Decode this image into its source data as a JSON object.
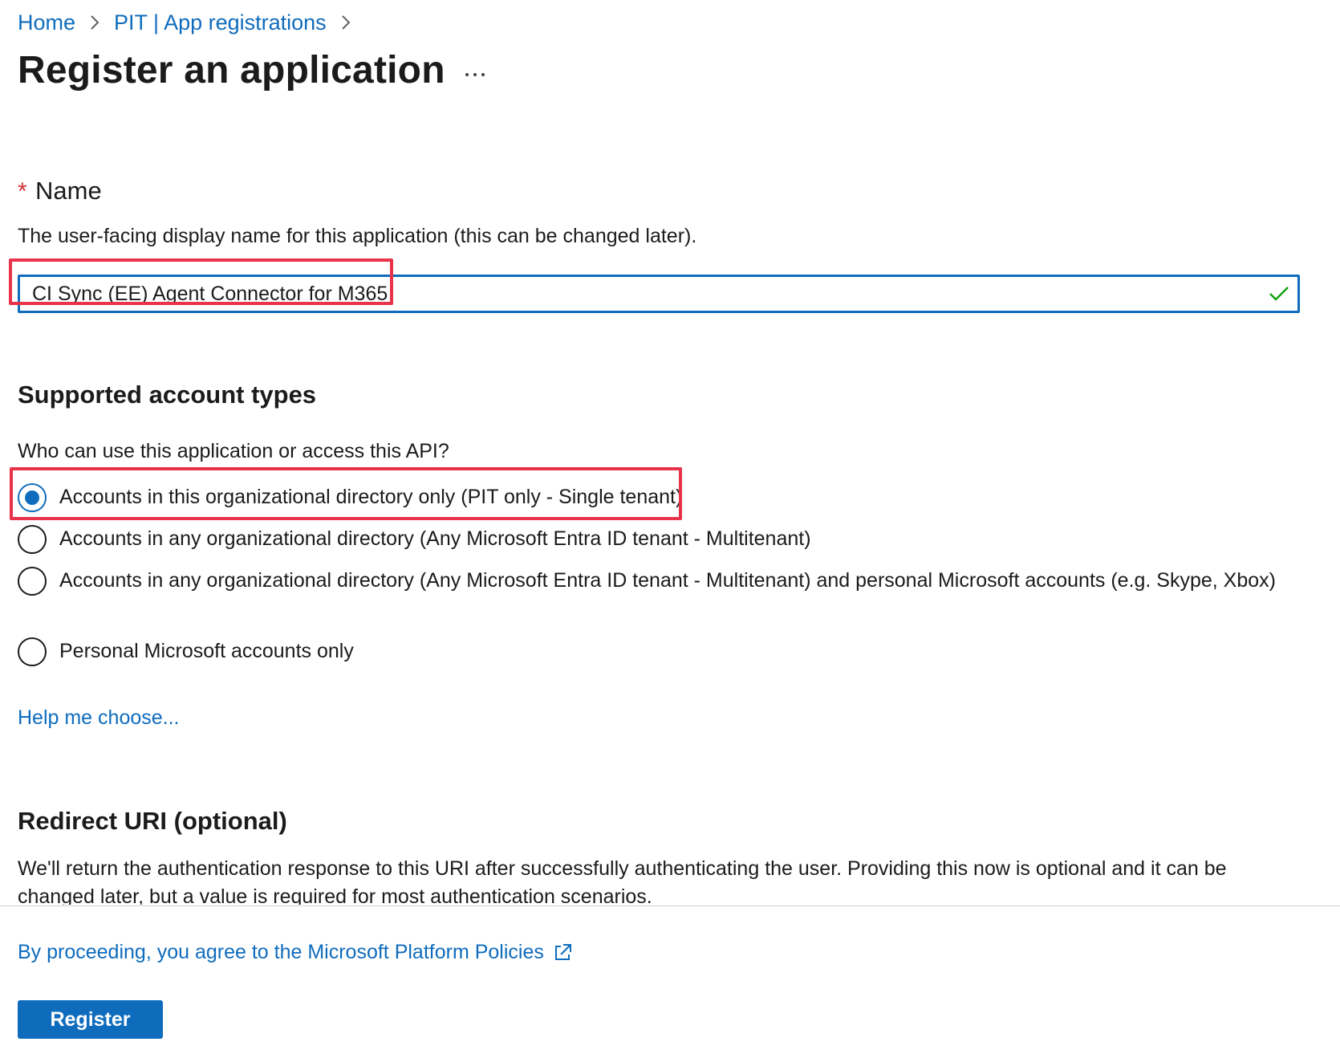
{
  "breadcrumb": {
    "items": [
      {
        "label": "Home"
      },
      {
        "label": "PIT | App registrations"
      }
    ]
  },
  "page": {
    "title": "Register an application",
    "more_icon": "ellipsis-icon"
  },
  "name_section": {
    "required_marker": "*",
    "label": "Name",
    "description": "The user-facing display name for this application (this can be changed later).",
    "input_value": "CI Sync (EE) Agent Connector for M365",
    "valid_icon": "checkmark-icon"
  },
  "account_types": {
    "title": "Supported account types",
    "question": "Who can use this application or access this API?",
    "options": [
      {
        "label": "Accounts in this organizational directory only (PIT only - Single tenant)",
        "selected": true
      },
      {
        "label": "Accounts in any organizational directory (Any Microsoft Entra ID tenant - Multitenant)",
        "selected": false
      },
      {
        "label": "Accounts in any organizational directory (Any Microsoft Entra ID tenant - Multitenant) and personal Microsoft accounts (e.g. Skype, Xbox)",
        "selected": false
      },
      {
        "label": "Personal Microsoft accounts only",
        "selected": false
      }
    ],
    "help_link": "Help me choose..."
  },
  "redirect": {
    "title": "Redirect URI (optional)",
    "description": "We'll return the authentication response to this URI after successfully authenticating the user. Providing this now is optional and it can be changed later, but a value is required for most authentication scenarios."
  },
  "footer": {
    "policy_link": "By proceeding, you agree to the Microsoft Platform Policies",
    "policy_icon": "external-link-icon",
    "register_label": "Register"
  },
  "colors": {
    "link": "#0f6cbd",
    "primary_button": "#0f6cbd",
    "highlight": "#e8334a",
    "required": "#d13438",
    "valid": "#13a10e"
  }
}
